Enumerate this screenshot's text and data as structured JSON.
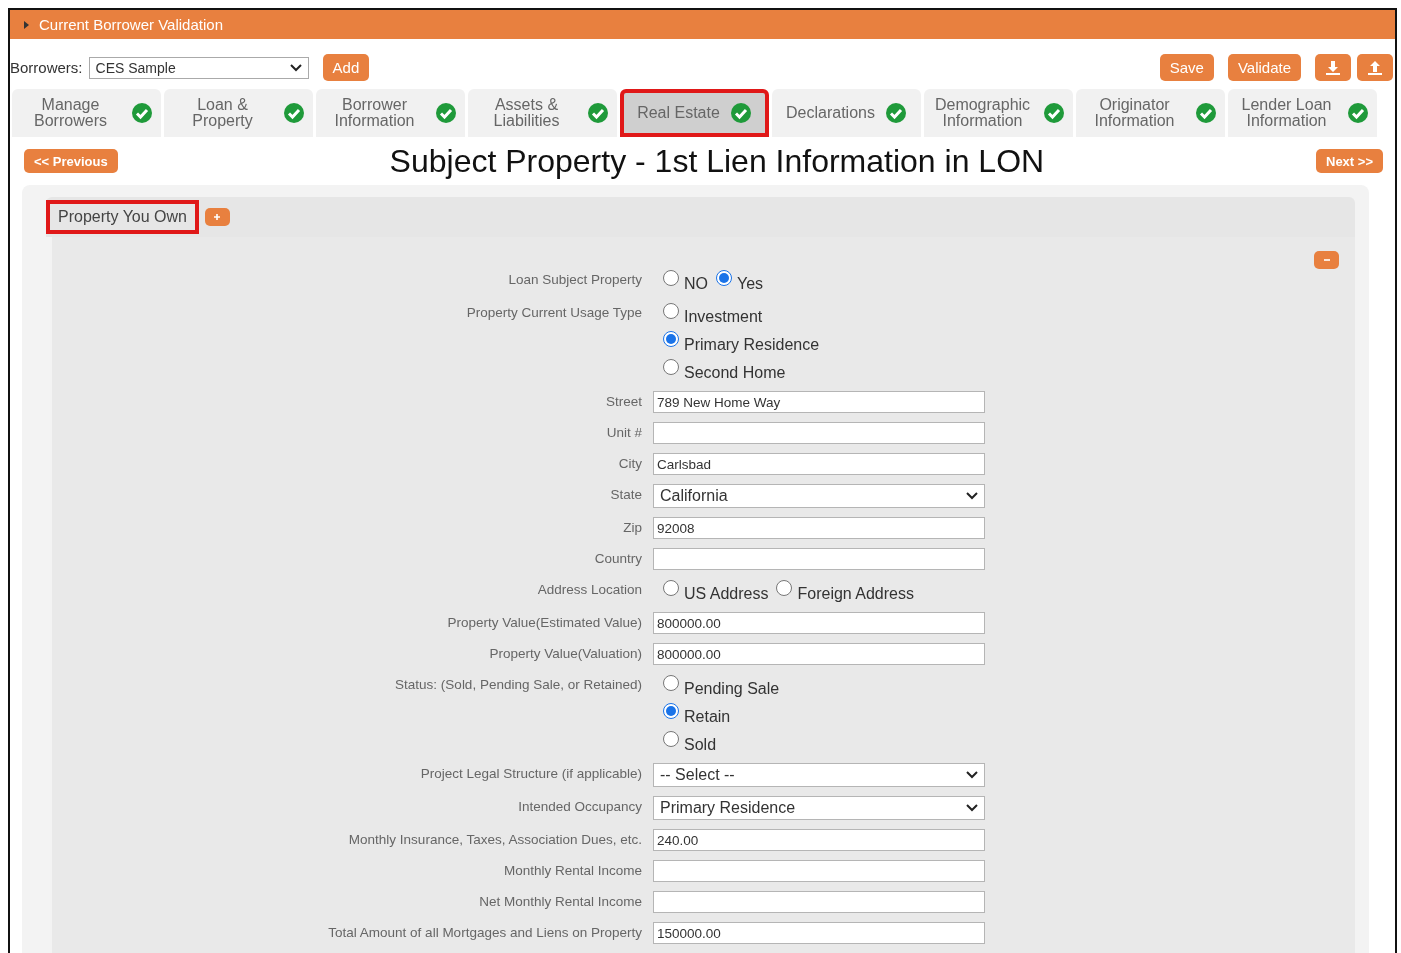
{
  "header": {
    "title": "Current Borrower Validation"
  },
  "toolbar": {
    "borrowers_label": "Borrowers:",
    "borrower_select": "CES Sample",
    "add": "Add",
    "save": "Save",
    "validate": "Validate"
  },
  "tabs": [
    {
      "label": "Manage Borrowers",
      "selected": false,
      "complete": true,
      "highlighted": false
    },
    {
      "label": "Loan & Property",
      "selected": false,
      "complete": true,
      "highlighted": false
    },
    {
      "label": "Borrower Information",
      "selected": false,
      "complete": true,
      "highlighted": false
    },
    {
      "label": "Assets & Liabilities",
      "selected": false,
      "complete": true,
      "highlighted": false
    },
    {
      "label": "Real Estate",
      "selected": true,
      "complete": true,
      "highlighted": true
    },
    {
      "label": "Declarations",
      "selected": false,
      "complete": true,
      "highlighted": false
    },
    {
      "label": "Demographic Information",
      "selected": false,
      "complete": true,
      "highlighted": false
    },
    {
      "label": "Originator Information",
      "selected": false,
      "complete": true,
      "highlighted": false
    },
    {
      "label": "Lender Loan Information",
      "selected": false,
      "complete": true,
      "highlighted": false
    }
  ],
  "nav": {
    "previous": "<< Previous",
    "next": "Next >>"
  },
  "page_title": "Subject Property - 1st Lien Information in LON",
  "section": {
    "title": "Property You Own",
    "highlighted": true
  },
  "fields": [
    {
      "kind": "radio",
      "label": "Loan Subject Property",
      "options": [
        {
          "label": "NO",
          "selected": false
        },
        {
          "label": "Yes",
          "selected": true
        }
      ]
    },
    {
      "kind": "radio_list",
      "label": "Property Current Usage Type",
      "options": [
        {
          "label": "Investment",
          "selected": false
        },
        {
          "label": "Primary Residence",
          "selected": true
        },
        {
          "label": "Second Home",
          "selected": false
        }
      ]
    },
    {
      "kind": "text",
      "label": "Street",
      "value": "789 New Home Way"
    },
    {
      "kind": "text",
      "label": "Unit #"
    },
    {
      "kind": "text",
      "label": "City",
      "value": "Carlsbad"
    },
    {
      "kind": "select",
      "label": "State",
      "value": "California"
    },
    {
      "kind": "text",
      "label": "Zip",
      "value": "92008"
    },
    {
      "kind": "text",
      "label": "Country"
    },
    {
      "kind": "radio",
      "label": "Address Location",
      "options": [
        {
          "label": "US Address",
          "selected": false
        },
        {
          "label": "Foreign Address",
          "selected": false
        }
      ]
    },
    {
      "kind": "text",
      "label": "Property Value(Estimated Value)",
      "value": "800000.00"
    },
    {
      "kind": "text",
      "label": "Property Value(Valuation)",
      "value": "800000.00"
    },
    {
      "kind": "radio_list",
      "label": "Status: (Sold, Pending Sale, or Retained)",
      "options": [
        {
          "label": "Pending Sale",
          "selected": false
        },
        {
          "label": "Retain",
          "selected": true
        },
        {
          "label": "Sold",
          "selected": false
        }
      ]
    },
    {
      "kind": "select",
      "label": "Project Legal Structure (if applicable)",
      "value": "-- Select --"
    },
    {
      "kind": "select",
      "label": "Intended Occupancy",
      "value": "Primary Residence"
    },
    {
      "kind": "text",
      "label": "Monthly Insurance, Taxes, Association Dues, etc.",
      "value": "240.00"
    },
    {
      "kind": "text",
      "label": "Monthly Rental Income"
    },
    {
      "kind": "text",
      "label": "Net Monthly Rental Income"
    },
    {
      "kind": "text",
      "label": "Total Amount of all Mortgages and Liens on Property",
      "value": "150000.00"
    }
  ]
}
